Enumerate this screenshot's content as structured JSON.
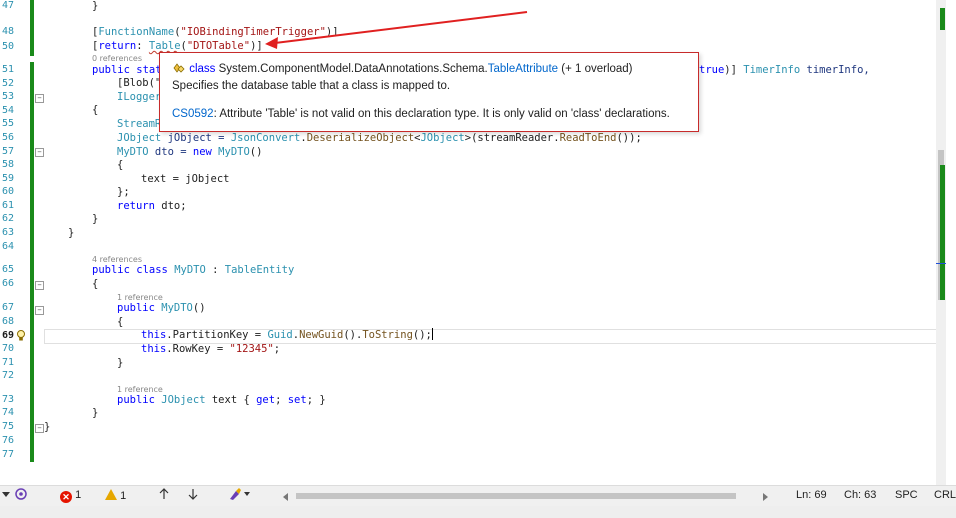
{
  "line_numbers": [
    "47",
    "48",
    "50",
    "51",
    "52",
    "53",
    "54",
    "55",
    "56",
    "57",
    "58",
    "59",
    "60",
    "61",
    "62",
    "63",
    "64",
    "65",
    "66",
    "67",
    "68",
    "69",
    "70",
    "71",
    "72",
    "73",
    "74",
    "75",
    "76",
    "77"
  ],
  "code": {
    "l47": "}",
    "l48_a": "[",
    "l48_b": "FunctionName",
    "l48_c": "(",
    "l48_d": "\"IOBindingTimerTrigger\"",
    "l48_e": ")]",
    "l50_a": "[",
    "l50_b": "return",
    "l50_c": ": ",
    "l50_d": "Table",
    "l50_e": "(",
    "l50_f": "\"DTOTable\"",
    "l50_g": ")]",
    "refs_51": "0 references",
    "l51_a": "public stat",
    "l51_b": "true",
    "l51_c": ")] ",
    "l51_d": "TimerInfo",
    "l51_e": " timerInfo,",
    "l52": "[Blob(\"",
    "l53": "ILogger",
    "l54": "{",
    "l55": "StreamR",
    "l56_a": "JObject",
    "l56_b": " jObject = ",
    "l56_c": "JsonConvert",
    "l56_d": ".",
    "l56_e": "DeserializeObject",
    "l56_f": "<",
    "l56_g": "JObject",
    "l56_h": ">(streamReader.",
    "l56_i": "ReadToEnd",
    "l56_j": "());",
    "l57_a": "MyDTO",
    "l57_b": " dto = ",
    "l57_c": "new",
    "l57_d": " ",
    "l57_e": "MyDTO",
    "l57_f": "()",
    "l58": "{",
    "l59": "text = jObject",
    "l60": "};",
    "l61_a": "return",
    "l61_b": " dto;",
    "l62": "}",
    "l63": "}",
    "refs_65": "4 references",
    "l65_a": "public class",
    "l65_b": " ",
    "l65_c": "MyDTO",
    "l65_d": " : ",
    "l65_e": "TableEntity",
    "l66": "{",
    "refs_67": "1 reference",
    "l67_a": "public",
    "l67_b": " ",
    "l67_c": "MyDTO",
    "l67_d": "()",
    "l68": "{",
    "l69_a": "this",
    "l69_b": ".PartitionKey = ",
    "l69_c": "Guid",
    "l69_d": ".",
    "l69_e": "NewGuid",
    "l69_f": "().",
    "l69_g": "ToString",
    "l69_h": "();",
    "l70_a": "this",
    "l70_b": ".RowKey = ",
    "l70_c": "\"12345\"",
    "l70_d": ";",
    "l71": "}",
    "refs_73": "1 reference",
    "l73_a": "public",
    "l73_b": " ",
    "l73_c": "JObject",
    "l73_d": " text { ",
    "l73_e": "get",
    "l73_f": "; ",
    "l73_g": "set",
    "l73_h": "; }",
    "l74": "}",
    "l75": "}"
  },
  "tooltip": {
    "kind": "class",
    "ns": " System.ComponentModel.DataAnnotations.Schema.",
    "type_name": "TableAttribute",
    "overload": " (+ 1 overload)",
    "summary": "Specifies the database table that a class is mapped to.",
    "error_code": "CS0592",
    "error_msg": ": Attribute 'Table' is not valid on this declaration type. It is only valid on 'class' declarations."
  },
  "status": {
    "errors": "1",
    "warnings": "1",
    "line": "Ln: 69",
    "col": "Ch: 63",
    "spc": "SPC",
    "crlf": "CRLF"
  },
  "colors": {
    "error": "#e51400",
    "warning": "#e6a700",
    "change_bar": "#1a8a1a",
    "annotation_arrow": "#e02020"
  },
  "icons": [
    "lightbulb-icon",
    "error-icon",
    "warning-icon",
    "up-arrow-icon",
    "down-arrow-icon",
    "brush-icon",
    "dropdown-icon",
    "scroll-left-icon",
    "scroll-right-icon",
    "git-icon"
  ]
}
